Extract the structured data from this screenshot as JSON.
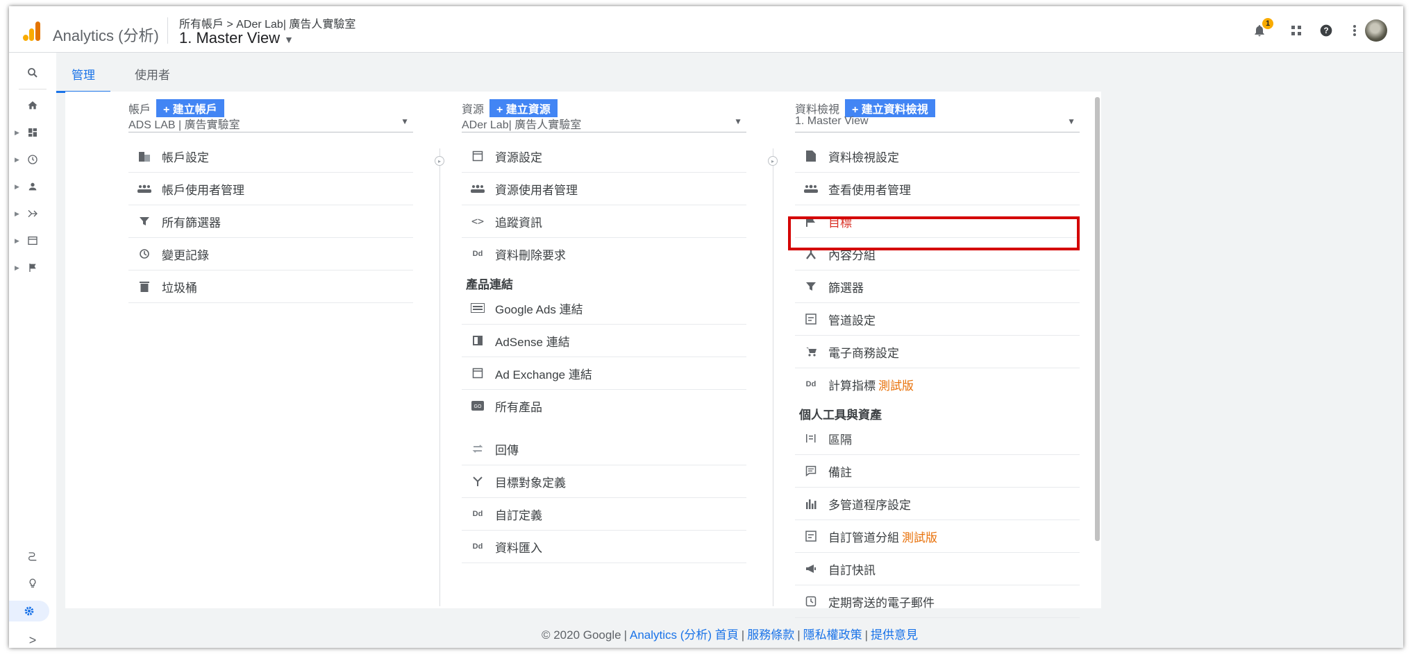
{
  "header": {
    "app_name": "Analytics (分析)",
    "breadcrumb": "所有帳戶 > ADer Lab| 廣告人實驗室",
    "view_name": "1. Master View",
    "notification_count": "1"
  },
  "tabs": [
    {
      "label": "管理",
      "active": true
    },
    {
      "label": "使用者",
      "active": false
    }
  ],
  "account": {
    "heading": "帳戶",
    "create_label": "+ 建立帳戶",
    "selected": "ADS LAB | 廣告實驗室",
    "items": [
      "帳戶設定",
      "帳戶使用者管理",
      "所有篩選器",
      "變更記錄",
      "垃圾桶"
    ]
  },
  "property": {
    "heading": "資源",
    "create_label": "+ 建立資源",
    "selected": "ADer Lab| 廣告人實驗室",
    "items": [
      "資源設定",
      "資源使用者管理",
      "追蹤資訊",
      "資料刪除要求"
    ],
    "section_products": "產品連結",
    "product_items": [
      "Google Ads 連結",
      "AdSense 連結",
      "Ad Exchange 連結",
      "所有產品"
    ],
    "other_items": [
      "回傳",
      "目標對象定義",
      "自訂定義",
      "資料匯入"
    ]
  },
  "view": {
    "heading": "資料檢視",
    "create_label": "+ 建立資料檢視",
    "selected": "1. Master View",
    "items": [
      "資料檢視設定",
      "查看使用者管理",
      "目標",
      "內容分組",
      "篩選器",
      "管道設定",
      "電子商務設定",
      "計算指標"
    ],
    "beta_label": "測試版",
    "section_personal": "個人工具與資產",
    "personal_items": [
      "區隔",
      "備註",
      "多管道程序設定",
      "自訂管道分組",
      "自訂快訊",
      "定期寄送的電子郵件"
    ]
  },
  "footer": {
    "copyright": "© 2020 Google",
    "links": [
      "Analytics (分析) 首頁",
      "服務條款",
      "隱私權政策",
      "提供意見"
    ]
  },
  "colors": {
    "accent": "#1a73e8",
    "create_button": "#4285f4",
    "highlight": "#d40000",
    "beta": "#e8710a",
    "selected_item": "#d93025"
  }
}
